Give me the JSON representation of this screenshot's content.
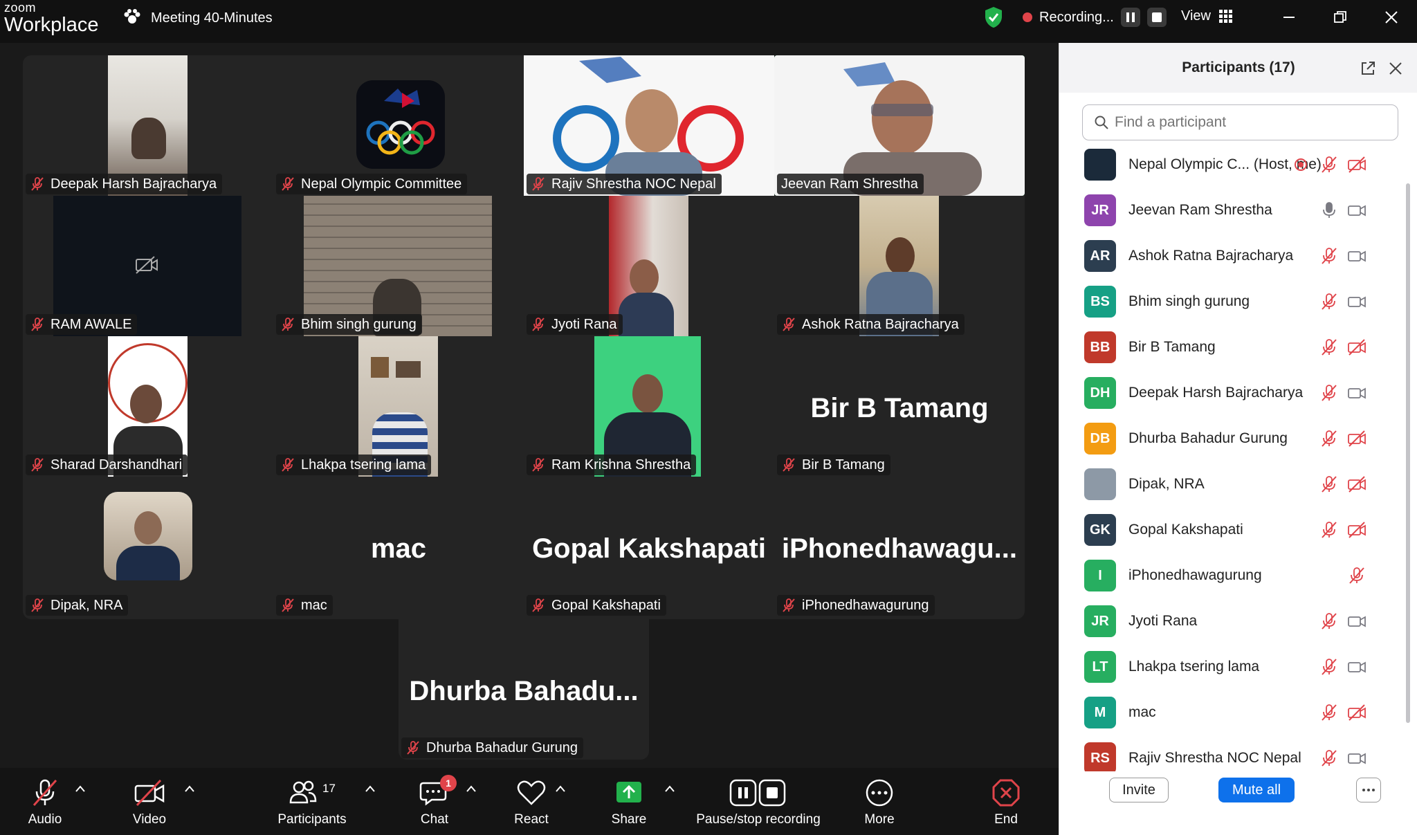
{
  "app": {
    "brand_top": "zoom",
    "brand_bottom": "Workplace",
    "meeting_title": "Meeting 40-Minutes"
  },
  "recording": {
    "status": "Recording..."
  },
  "view": {
    "label": "View"
  },
  "tiles": [
    {
      "name": "Deepak Harsh Bajracharya"
    },
    {
      "name": "Nepal Olympic Committee"
    },
    {
      "name": "Rajiv Shrestha NOC Nepal"
    },
    {
      "name": "Jeevan Ram Shrestha"
    },
    {
      "name": "RAM AWALE"
    },
    {
      "name": "Bhim singh gurung"
    },
    {
      "name": "Jyoti Rana"
    },
    {
      "name": "Ashok Ratna Bajracharya"
    },
    {
      "name": "Sharad Darshandhari"
    },
    {
      "name": "Lhakpa tsering lama"
    },
    {
      "name": "Ram Krishna Shrestha"
    },
    {
      "name": "Bir B Tamang",
      "big": "Bir B Tamang"
    },
    {
      "name": "Dipak, NRA"
    },
    {
      "name": "mac",
      "big": "mac"
    },
    {
      "name": "Gopal Kakshapati",
      "big": "Gopal Kakshapati"
    },
    {
      "name": "iPhonedhawagurung",
      "big": "iPhonedhawagu..."
    },
    {
      "name": "Dhurba Bahadur Gurung",
      "big": "Dhurba  Bahadu..."
    }
  ],
  "toolbar": {
    "audio": "Audio",
    "video": "Video",
    "participants": "Participants",
    "participants_count": "17",
    "chat": "Chat",
    "chat_badge": "1",
    "react": "React",
    "share": "Share",
    "pause_stop": "Pause/stop recording",
    "more": "More",
    "end": "End"
  },
  "panel": {
    "title": "Participants (17)",
    "search_placeholder": "Find a participant",
    "invite": "Invite",
    "mute_all": "Mute all",
    "participants": [
      {
        "initials": "",
        "name": "Nepal Olympic C... (Host, me)",
        "color": "#1b2a3a",
        "mic": "off",
        "cam": "off",
        "rec": true
      },
      {
        "initials": "JR",
        "name": "Jeevan Ram Shrestha",
        "color": "#8e44ad",
        "mic": "on",
        "cam": "on"
      },
      {
        "initials": "AR",
        "name": "Ashok Ratna Bajracharya",
        "color": "#2c3e50",
        "mic": "off",
        "cam": "on"
      },
      {
        "initials": "BS",
        "name": "Bhim singh gurung",
        "color": "#16a085",
        "mic": "off",
        "cam": "on"
      },
      {
        "initials": "BB",
        "name": "Bir B Tamang",
        "color": "#c0392b",
        "mic": "off",
        "cam": "off"
      },
      {
        "initials": "DH",
        "name": "Deepak Harsh Bajracharya",
        "color": "#27ae60",
        "mic": "off",
        "cam": "on"
      },
      {
        "initials": "DB",
        "name": "Dhurba Bahadur Gurung",
        "color": "#f39c12",
        "mic": "off",
        "cam": "off"
      },
      {
        "initials": "",
        "name": "Dipak, NRA",
        "color": "#8d99a6",
        "mic": "off",
        "cam": "off"
      },
      {
        "initials": "GK",
        "name": "Gopal Kakshapati",
        "color": "#2c3e50",
        "mic": "off",
        "cam": "off"
      },
      {
        "initials": "I",
        "name": "iPhonedhawagurung",
        "color": "#27ae60",
        "mic": "off",
        "cam": "none"
      },
      {
        "initials": "JR",
        "name": "Jyoti Rana",
        "color": "#27ae60",
        "mic": "off",
        "cam": "on"
      },
      {
        "initials": "LT",
        "name": "Lhakpa tsering lama",
        "color": "#27ae60",
        "mic": "off",
        "cam": "on"
      },
      {
        "initials": "M",
        "name": "mac",
        "color": "#16a085",
        "mic": "off",
        "cam": "off"
      },
      {
        "initials": "RS",
        "name": "Rajiv Shrestha NOC Nepal",
        "color": "#c0392b",
        "mic": "off",
        "cam": "on"
      }
    ]
  }
}
